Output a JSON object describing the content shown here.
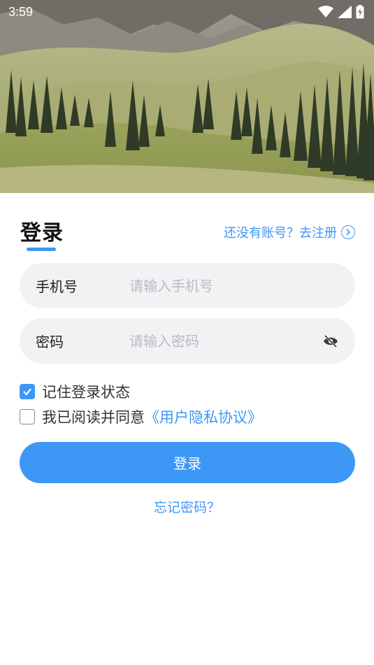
{
  "status_bar": {
    "time": "3:59",
    "icons": [
      "wifi-icon",
      "signal-icon",
      "battery-icon"
    ]
  },
  "hero": {
    "image": "mountain-meadow-landscape"
  },
  "header": {
    "title": "登录",
    "register_link": "还没有账号？去注册"
  },
  "form": {
    "phone_label": "手机号",
    "phone_placeholder": "请输入手机号",
    "phone_value": "",
    "password_label": "密码",
    "password_placeholder": "请输入密码",
    "password_value": "",
    "remember_label": "记住登录状态",
    "remember_checked": true,
    "agreement_prefix": "我已阅读并同意",
    "agreement_link": "《用户隐私协议》",
    "agreement_checked": false,
    "login_button": "登录",
    "forgot_link": "忘记密码？"
  },
  "colors": {
    "accent": "#3d97f5",
    "field_background": "#f1f2f4"
  }
}
